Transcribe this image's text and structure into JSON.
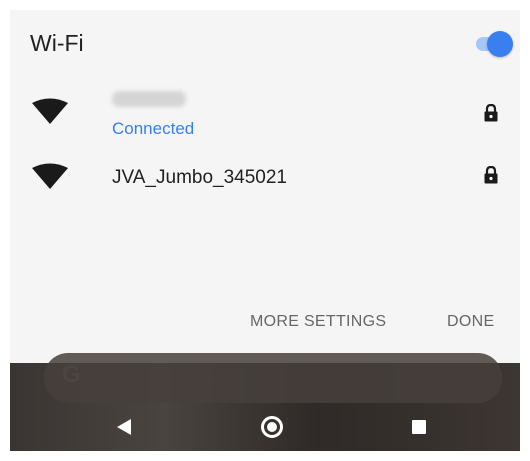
{
  "dialog": {
    "title": "Wi-Fi",
    "toggle_state": "on",
    "networks": [
      {
        "ssid": "",
        "ssid_obscured": true,
        "status": "Connected",
        "icon": "wifi-full-icon",
        "secured": true
      },
      {
        "ssid": "JVA_Jumbo_345021",
        "status": "",
        "icon": "wifi-full-icon",
        "secured": true
      }
    ],
    "actions": {
      "more_settings": "MORE SETTINGS",
      "done": "DONE"
    }
  },
  "background": {
    "search_logo": "G"
  },
  "navbar": {
    "icons": [
      "back-icon",
      "home-icon",
      "recents-icon"
    ]
  },
  "colors": {
    "accent": "#3a7ff0",
    "dialog_bg": "#f5f5f5",
    "action_text": "#666666"
  }
}
